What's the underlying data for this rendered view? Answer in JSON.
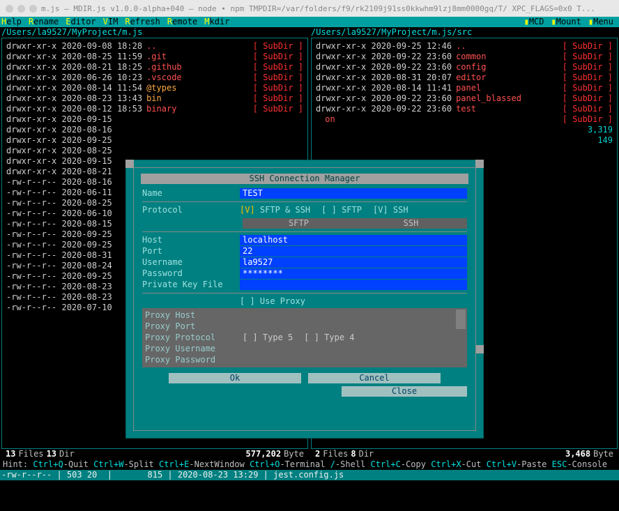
{
  "titlebar": "m.js — MDIR.js v1.0.0-alpha+040 — node ∙ npm TMPDIR=/var/folders/f9/rk2109j91ss0kkwhm9lzj8mm0000gq/T/ XPC_FLAGS=0x0 T...",
  "menu": {
    "help_key": "H",
    "help": "elp",
    "rename_key": "R",
    "rename": "ename",
    "editor_key": "E",
    "editor": "ditor",
    "vim_key": "V",
    "vim": "IM",
    "refresh_key": "R",
    "refresh": "efresh",
    "remote_key": "R",
    "remote": "emote",
    "mkdir_key": "M",
    "mkdir": "kdir",
    "mcd": "MCD",
    "mount": "Mount",
    "menu": "Menu"
  },
  "paths": {
    "left": "/Users/la9527/MyProject/m.js",
    "right": "/Users/la9527/MyProject/m.js/src"
  },
  "leftRows": [
    {
      "perms": "drwxr-xr-x",
      "date": "2020-09-08 18:28",
      "name": "..",
      "cls": "red",
      "tag": "[ SubDir ]"
    },
    {
      "perms": "drwxr-xr-x",
      "date": "2020-08-25 11:59",
      "name": ".git",
      "cls": "red",
      "tag": "[ SubDir ]"
    },
    {
      "perms": "drwxr-xr-x",
      "date": "2020-08-21 18:25",
      "name": ".github",
      "cls": "red",
      "tag": "[ SubDir ]"
    },
    {
      "perms": "drwxr-xr-x",
      "date": "2020-06-26 10:23",
      "name": ".vscode",
      "cls": "red",
      "tag": "[ SubDir ]"
    },
    {
      "perms": "drwxr-xr-x",
      "date": "2020-08-14 11:54",
      "name": "@types",
      "cls": "orange",
      "tag": "[ SubDir ]"
    },
    {
      "perms": "drwxr-xr-x",
      "date": "2020-08-23 13:43",
      "name": "bin",
      "cls": "orange",
      "tag": "[ SubDir ]"
    },
    {
      "perms": "drwxr-xr-x",
      "date": "2020-08-12 18:53",
      "name": "binary",
      "cls": "red",
      "tag": "[ SubDir ]"
    },
    {
      "perms": "drwxr-xr-x",
      "date": "2020-09-15",
      "name": "",
      "cls": "",
      "tag": ""
    },
    {
      "perms": "drwxr-xr-x",
      "date": "2020-08-16",
      "name": "",
      "cls": "",
      "tag": ""
    },
    {
      "perms": "drwxr-xr-x",
      "date": "2020-09-25",
      "name": "",
      "cls": "",
      "tag": ""
    },
    {
      "perms": "drwxr-xr-x",
      "date": "2020-08-25",
      "name": "",
      "cls": "",
      "tag": ""
    },
    {
      "perms": "drwxr-xr-x",
      "date": "2020-09-15",
      "name": "",
      "cls": "",
      "tag": ""
    },
    {
      "perms": "drwxr-xr-x",
      "date": "2020-08-21",
      "name": "",
      "cls": "",
      "tag": ""
    },
    {
      "perms": "-rw-r--r--",
      "date": "2020-08-16",
      "name": "",
      "cls": "",
      "tag": ""
    },
    {
      "perms": "-rw-r--r--",
      "date": "2020-06-11",
      "name": "",
      "cls": "",
      "tag": ""
    },
    {
      "perms": "-rw-r--r--",
      "date": "2020-08-25",
      "name": "",
      "cls": "",
      "tag": ""
    },
    {
      "perms": "-rw-r--r--",
      "date": "2020-06-10",
      "name": "",
      "cls": "",
      "tag": ""
    },
    {
      "perms": "-rw-r--r--",
      "date": "2020-08-15",
      "name": "",
      "cls": "",
      "tag": ""
    },
    {
      "perms": "-rw-r--r--",
      "date": "2020-09-25",
      "name": "",
      "cls": "",
      "tag": ""
    },
    {
      "perms": "-rw-r--r--",
      "date": "2020-09-25",
      "name": "",
      "cls": "",
      "tag": ""
    },
    {
      "perms": "-rw-r--r--",
      "date": "2020-08-31",
      "name": "",
      "cls": "",
      "tag": ""
    },
    {
      "perms": "-rw-r--r--",
      "date": "2020-08-24",
      "name": "",
      "cls": "",
      "tag": ""
    },
    {
      "perms": "-rw-r--r--",
      "date": "2020-09-25",
      "name": "",
      "cls": "",
      "tag": ""
    },
    {
      "perms": "-rw-r--r--",
      "date": "2020-08-23",
      "name": "",
      "cls": "",
      "tag": ""
    },
    {
      "perms": "-rw-r--r--",
      "date": "2020-08-23",
      "name": "",
      "cls": "",
      "tag": ""
    },
    {
      "perms": "-rw-r--r--",
      "date": "2020-07-10",
      "name": "",
      "cls": "",
      "tag": ""
    }
  ],
  "rightRows": [
    {
      "perms": "drwxr-xr-x",
      "date": "2020-09-25 12:46",
      "name": "..",
      "cls": "red",
      "tag": "[ SubDir ]"
    },
    {
      "perms": "drwxr-xr-x",
      "date": "2020-09-22 23:60",
      "name": "common",
      "cls": "red",
      "tag": "[ SubDir ]"
    },
    {
      "perms": "drwxr-xr-x",
      "date": "2020-09-22 23:60",
      "name": "config",
      "cls": "red",
      "tag": "[ SubDir ]"
    },
    {
      "perms": "drwxr-xr-x",
      "date": "2020-08-31 20:07",
      "name": "editor",
      "cls": "red",
      "tag": "[ SubDir ]"
    },
    {
      "perms": "drwxr-xr-x",
      "date": "2020-08-14 11:41",
      "name": "panel",
      "cls": "red",
      "tag": "[ SubDir ]"
    },
    {
      "perms": "drwxr-xr-x",
      "date": "2020-09-22 23:60",
      "name": "panel_blassed",
      "cls": "red",
      "tag": "[ SubDir ]"
    },
    {
      "perms": "drwxr-xr-x",
      "date": "2020-09-22 23:60",
      "name": "test",
      "cls": "red",
      "tag": "[ SubDir ]"
    },
    {
      "perms": "",
      "date": "",
      "name": "on",
      "cls": "red",
      "tag": "[ SubDir ]"
    },
    {
      "perms": "",
      "date": "",
      "name": "",
      "cls": "",
      "tag": "3,319"
    },
    {
      "perms": "",
      "date": "",
      "name": "",
      "cls": "",
      "tag": "149"
    }
  ],
  "stats": {
    "left_files": "13",
    "left_files_lbl": " Files   ",
    "left_dirs": "13",
    "left_dirs_lbl": " Dir",
    "left_bytes": "577,202",
    "left_bytes_lbl": " Byte",
    "right_files": "2",
    "right_files_lbl": " Files   ",
    "right_dirs": "8",
    "right_dirs_lbl": " Dir",
    "right_bytes": "3,468",
    "right_bytes_lbl": " Byte"
  },
  "hint": {
    "prefix": "Hint: ",
    "k1": "Ctrl+Q",
    "t1": "-Quit ",
    "k2": "Ctrl+W",
    "t2": "-Split ",
    "k3": "Ctrl+E",
    "t3": "-NextWindow ",
    "k4": "Ctrl+O",
    "t4": "-Terminal ",
    "k45": "/",
    "t45": "-Shell ",
    "k5": "Ctrl+C",
    "t5": "-Copy ",
    "k6": "Ctrl+X",
    "t6": "-Cut ",
    "k7": "Ctrl+V",
    "t7": "-Paste ",
    "k8": "ESC",
    "t8": "-Console"
  },
  "status": "-rw-r--r-- | 503 20  |       815 | 2020-08-23 13:29 | jest.config.js",
  "dialog": {
    "title": "SSH Connection Manager",
    "name_label": "Name",
    "name_value": "TEST",
    "protocol_label": "Protocol",
    "proto_both": "[V] SFTP & SSH",
    "proto_sftp": "[ ] SFTP",
    "proto_ssh": "[V] SSH",
    "tab_sftp": "SFTP",
    "tab_ssh": "SSH",
    "host_label": "Host",
    "host_value": "localhost",
    "port_label": "Port",
    "port_value": "22",
    "user_label": "Username",
    "user_value": "la9527",
    "pass_label": "Password",
    "pass_value": "********",
    "key_label": "Private Key File",
    "key_value": "",
    "useproxy": "[ ] Use Proxy",
    "proxy_host": "Proxy Host",
    "proxy_port": "Proxy Port",
    "proxy_proto": "Proxy Protocol",
    "proxy_type5": "[ ] Type 5",
    "proxy_type4": "[ ] Type 4",
    "proxy_user": "Proxy Username",
    "proxy_pass": "Proxy Password",
    "ok": "Ok",
    "cancel": "Cancel",
    "close": "Close"
  }
}
